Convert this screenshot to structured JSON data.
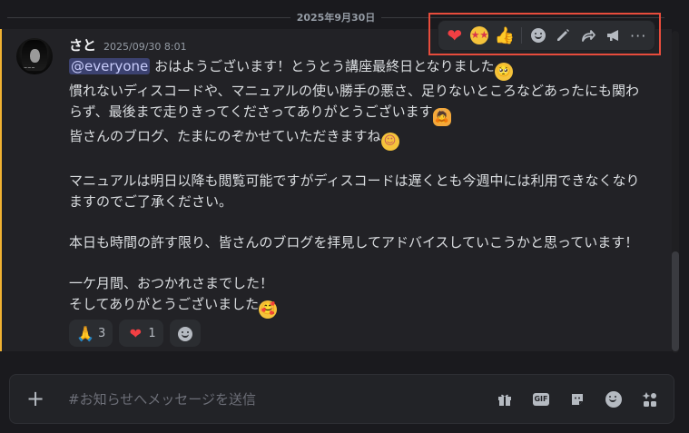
{
  "divider": {
    "date": "2025年9月30日"
  },
  "message": {
    "username": "さと",
    "timestamp": "2025/09/30 8:01",
    "mention": "@everyone",
    "body_part1": " おはようございます！とうとう講座最終日となりました",
    "body_part2": "\n慣れないディスコードや、マニュアルの使い勝手の悪さ、足りないところなどあったにも関わらず、最後まで走りきってくださってありがとうございます",
    "body_part3": "\n皆さんのブログ、たまにのぞかせていただきますね",
    "body_part4": "\n\nマニュアルは明日以降も閲覧可能ですがディスコードは遅くとも今週中には利用できなくなりますのでご了承ください。\n\n本日も時間の許す限り、皆さんのブログを拝見してアドバイスしていこうかと思っています！\n\n一ケ月間、おつかれさまでした！\nそしてありがとうございました",
    "inline_emojis": [
      "pleading-face",
      "person-bowing",
      "smiling-face",
      "smiling-face-with-hearts"
    ],
    "reactions": [
      {
        "emoji": "🙏",
        "name": "folded-hands",
        "count": "3"
      },
      {
        "emoji": "❤",
        "name": "red-heart",
        "count": "1"
      }
    ]
  },
  "toolbar": {
    "icons": [
      "red-heart",
      "star-struck",
      "thumbs-up",
      "add-reaction",
      "edit",
      "forward",
      "announce",
      "more"
    ],
    "colors": {
      "highlight": "#e74c3c",
      "heart": "#f23f43"
    }
  },
  "composer": {
    "placeholder": "#お知らせへメッセージを送信",
    "gif_label": "GIF"
  },
  "colors": {
    "mention_highlight_bar": "#f0b232",
    "background": "#1a1a1e"
  }
}
